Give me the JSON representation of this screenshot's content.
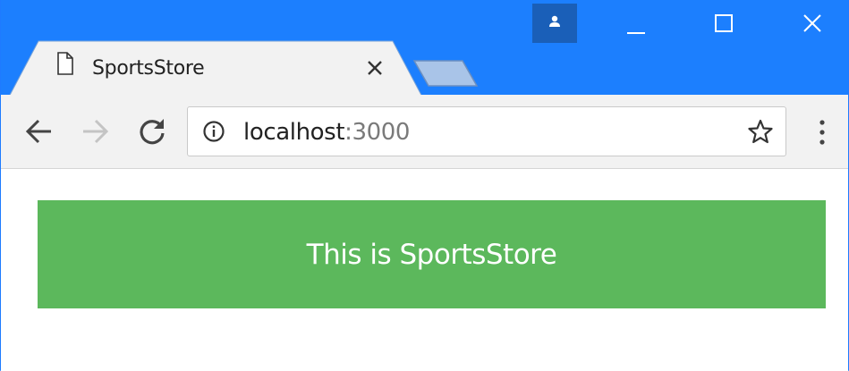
{
  "browser": {
    "tab": {
      "title": "SportsStore"
    },
    "address_bar": {
      "host": "localhost",
      "port": ":3000"
    },
    "icons": {
      "profile": "profile-icon",
      "minimize": "minimize-icon",
      "maximize": "maximize-icon",
      "close": "close-icon",
      "favicon": "page-icon",
      "tab_close": "close-icon",
      "back": "arrow-left-icon",
      "forward": "arrow-right-icon",
      "reload": "reload-icon",
      "info": "info-icon",
      "bookmark": "star-icon",
      "menu": "kebab-menu-icon"
    },
    "colors": {
      "titlebar": "#1c7ffe",
      "toolbar": "#f2f2f2"
    }
  },
  "page": {
    "banner_text": "This is SportsStore",
    "banner_color": "#5cb85c"
  }
}
